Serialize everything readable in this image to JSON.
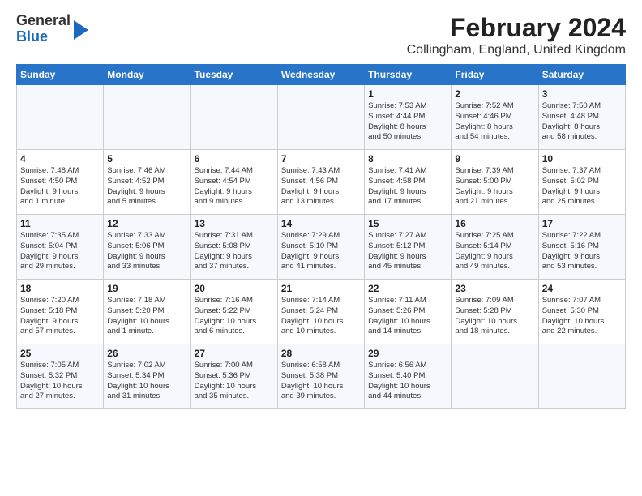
{
  "logo": {
    "line1": "General",
    "line2": "Blue"
  },
  "title": "February 2024",
  "subtitle": "Collingham, England, United Kingdom",
  "headers": [
    "Sunday",
    "Monday",
    "Tuesday",
    "Wednesday",
    "Thursday",
    "Friday",
    "Saturday"
  ],
  "weeks": [
    [
      {
        "day": "",
        "text": ""
      },
      {
        "day": "",
        "text": ""
      },
      {
        "day": "",
        "text": ""
      },
      {
        "day": "",
        "text": ""
      },
      {
        "day": "1",
        "text": "Sunrise: 7:53 AM\nSunset: 4:44 PM\nDaylight: 8 hours\nand 50 minutes."
      },
      {
        "day": "2",
        "text": "Sunrise: 7:52 AM\nSunset: 4:46 PM\nDaylight: 8 hours\nand 54 minutes."
      },
      {
        "day": "3",
        "text": "Sunrise: 7:50 AM\nSunset: 4:48 PM\nDaylight: 8 hours\nand 58 minutes."
      }
    ],
    [
      {
        "day": "4",
        "text": "Sunrise: 7:48 AM\nSunset: 4:50 PM\nDaylight: 9 hours\nand 1 minute."
      },
      {
        "day": "5",
        "text": "Sunrise: 7:46 AM\nSunset: 4:52 PM\nDaylight: 9 hours\nand 5 minutes."
      },
      {
        "day": "6",
        "text": "Sunrise: 7:44 AM\nSunset: 4:54 PM\nDaylight: 9 hours\nand 9 minutes."
      },
      {
        "day": "7",
        "text": "Sunrise: 7:43 AM\nSunset: 4:56 PM\nDaylight: 9 hours\nand 13 minutes."
      },
      {
        "day": "8",
        "text": "Sunrise: 7:41 AM\nSunset: 4:58 PM\nDaylight: 9 hours\nand 17 minutes."
      },
      {
        "day": "9",
        "text": "Sunrise: 7:39 AM\nSunset: 5:00 PM\nDaylight: 9 hours\nand 21 minutes."
      },
      {
        "day": "10",
        "text": "Sunrise: 7:37 AM\nSunset: 5:02 PM\nDaylight: 9 hours\nand 25 minutes."
      }
    ],
    [
      {
        "day": "11",
        "text": "Sunrise: 7:35 AM\nSunset: 5:04 PM\nDaylight: 9 hours\nand 29 minutes."
      },
      {
        "day": "12",
        "text": "Sunrise: 7:33 AM\nSunset: 5:06 PM\nDaylight: 9 hours\nand 33 minutes."
      },
      {
        "day": "13",
        "text": "Sunrise: 7:31 AM\nSunset: 5:08 PM\nDaylight: 9 hours\nand 37 minutes."
      },
      {
        "day": "14",
        "text": "Sunrise: 7:29 AM\nSunset: 5:10 PM\nDaylight: 9 hours\nand 41 minutes."
      },
      {
        "day": "15",
        "text": "Sunrise: 7:27 AM\nSunset: 5:12 PM\nDaylight: 9 hours\nand 45 minutes."
      },
      {
        "day": "16",
        "text": "Sunrise: 7:25 AM\nSunset: 5:14 PM\nDaylight: 9 hours\nand 49 minutes."
      },
      {
        "day": "17",
        "text": "Sunrise: 7:22 AM\nSunset: 5:16 PM\nDaylight: 9 hours\nand 53 minutes."
      }
    ],
    [
      {
        "day": "18",
        "text": "Sunrise: 7:20 AM\nSunset: 5:18 PM\nDaylight: 9 hours\nand 57 minutes."
      },
      {
        "day": "19",
        "text": "Sunrise: 7:18 AM\nSunset: 5:20 PM\nDaylight: 10 hours\nand 1 minute."
      },
      {
        "day": "20",
        "text": "Sunrise: 7:16 AM\nSunset: 5:22 PM\nDaylight: 10 hours\nand 6 minutes."
      },
      {
        "day": "21",
        "text": "Sunrise: 7:14 AM\nSunset: 5:24 PM\nDaylight: 10 hours\nand 10 minutes."
      },
      {
        "day": "22",
        "text": "Sunrise: 7:11 AM\nSunset: 5:26 PM\nDaylight: 10 hours\nand 14 minutes."
      },
      {
        "day": "23",
        "text": "Sunrise: 7:09 AM\nSunset: 5:28 PM\nDaylight: 10 hours\nand 18 minutes."
      },
      {
        "day": "24",
        "text": "Sunrise: 7:07 AM\nSunset: 5:30 PM\nDaylight: 10 hours\nand 22 minutes."
      }
    ],
    [
      {
        "day": "25",
        "text": "Sunrise: 7:05 AM\nSunset: 5:32 PM\nDaylight: 10 hours\nand 27 minutes."
      },
      {
        "day": "26",
        "text": "Sunrise: 7:02 AM\nSunset: 5:34 PM\nDaylight: 10 hours\nand 31 minutes."
      },
      {
        "day": "27",
        "text": "Sunrise: 7:00 AM\nSunset: 5:36 PM\nDaylight: 10 hours\nand 35 minutes."
      },
      {
        "day": "28",
        "text": "Sunrise: 6:58 AM\nSunset: 5:38 PM\nDaylight: 10 hours\nand 39 minutes."
      },
      {
        "day": "29",
        "text": "Sunrise: 6:56 AM\nSunset: 5:40 PM\nDaylight: 10 hours\nand 44 minutes."
      },
      {
        "day": "",
        "text": ""
      },
      {
        "day": "",
        "text": ""
      }
    ]
  ]
}
